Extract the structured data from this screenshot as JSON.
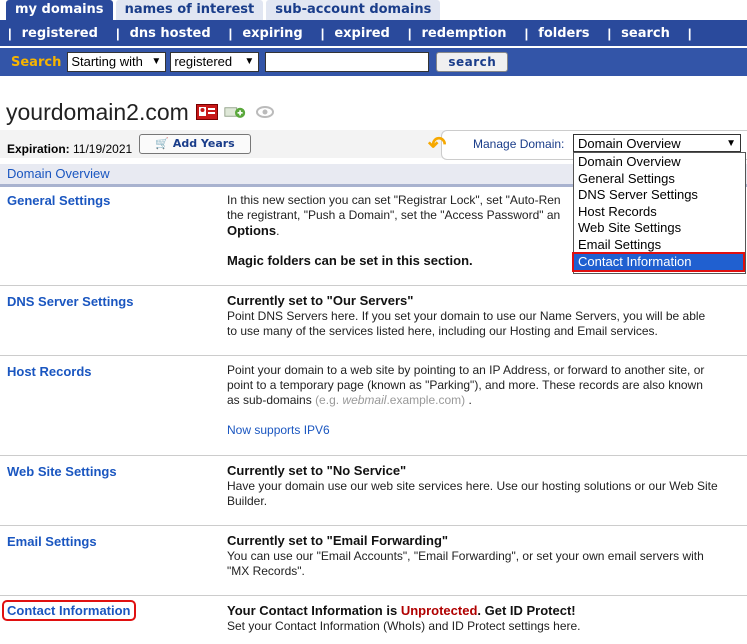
{
  "tabs": [
    "my domains",
    "names of interest",
    "sub-account domains"
  ],
  "nav": [
    "registered",
    "dns hosted",
    "expiring",
    "expired",
    "redemption",
    "folders",
    "search"
  ],
  "search": {
    "label": "Search",
    "mode": "Starting with",
    "scope": "registered",
    "button": "search",
    "value": ""
  },
  "domain": {
    "name": "yourdomain2.com",
    "expiration_label": "Expiration:",
    "expiration": "11/19/2021",
    "add_years": "Add Years"
  },
  "manage": {
    "label": "Manage Domain:",
    "selected": "Domain Overview",
    "options": [
      "Domain Overview",
      "General Settings",
      "DNS Server Settings",
      "Host Records",
      "Web Site Settings",
      "Email Settings",
      "Contact Information"
    ]
  },
  "overview_title": "Domain Overview",
  "sections": {
    "general": {
      "title": "General Settings",
      "l1": "In this new section you can set \"Registrar Lock\", set \"Auto-Ren",
      "l2": "the registrant, \"Push a Domain\", set the \"Access Password\" an",
      "l3": "Options",
      "l3_end": ".",
      "l4": "Magic folders can be set in this section."
    },
    "dns": {
      "title": "DNS Server Settings",
      "heading": "Currently set to \"Our Servers\"",
      "l1": "Point DNS Servers here. If you set your domain to use our Name Servers, you will be able",
      "l2": "to use many of the services listed here, including our Hosting and Email services."
    },
    "host": {
      "title": "Host Records",
      "l1": "Point your domain to a web site by pointing to an IP Address, or forward to another site, or",
      "l2": "point to a temporary page (known as \"Parking\"), and more. These records are also known",
      "l3a": "as sub-domains",
      "l3b": "(e.g. ",
      "l3c": "webmail",
      "l3d": ".example.com)",
      "l3e": " .",
      "ipv6": "Now supports IPV6"
    },
    "web": {
      "title": "Web Site Settings",
      "heading": "Currently set to \"No Service\"",
      "l1": "Have your domain use our web site services here. Use our hosting solutions or our Web Site",
      "l2": "Builder."
    },
    "email": {
      "title": "Email Settings",
      "heading": "Currently set to \"Email Forwarding\"",
      "l1": "You can use our \"Email Accounts\", \"Email Forwarding\", or set your own email servers with",
      "l2": "\"MX Records\"."
    },
    "contact": {
      "title": "Contact Information",
      "h1": "Your Contact Information is ",
      "h2": "Unprotected",
      "h3": ". Get ID Protect!",
      "l1": "Set your Contact Information (WhoIs) and ID Protect settings here."
    }
  }
}
